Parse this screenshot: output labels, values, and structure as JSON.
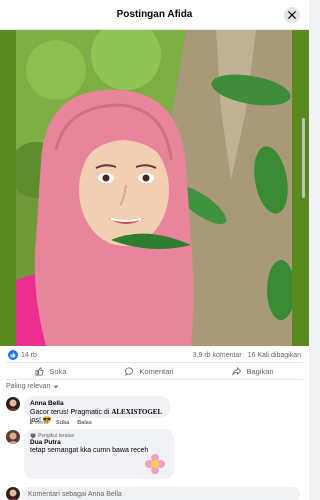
{
  "header": {
    "title": "Postingan Afida"
  },
  "post": {
    "reactions_count": "14 rb",
    "comments_count": "3,9 rb komentar",
    "shares_count": "16 Kali dibagikan"
  },
  "actions": {
    "like": "Suka",
    "comment": "Komentari",
    "share": "Bagikan"
  },
  "sort": {
    "label": "Paling relevan"
  },
  "comments": [
    {
      "author": "Anna Bella",
      "text_prefix": "Gacor terus! Pragmatic di ",
      "text_bold": "ALEXISTOGEL",
      "text_suffix": " jos! 😎",
      "time": "1 menit",
      "like": "Suka",
      "reply": "Balas"
    },
    {
      "badge": "Pengikut teratas",
      "author": "Dua Putra",
      "text": "tetap semangat kka cumn bawa receh"
    }
  ],
  "composer": {
    "placeholder": "Komentari sebagai Anna Bella"
  },
  "colors": {
    "accent": "#1877f2",
    "frame": "#5a8a1f",
    "headscarf": "#e8849c",
    "shirt": "#ec2f8f"
  }
}
